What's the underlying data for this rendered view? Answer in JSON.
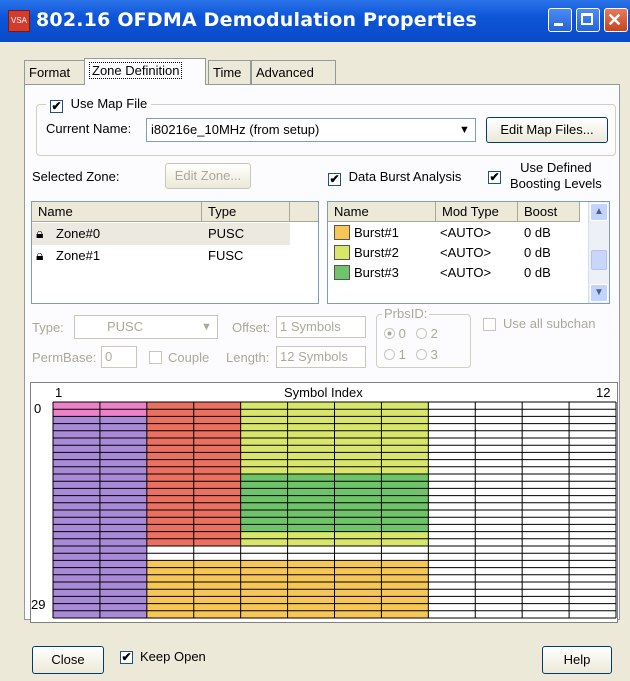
{
  "window": {
    "title": "802.16 OFDMA Demodulation Properties",
    "app_icon": "VSA"
  },
  "tabs": [
    {
      "label": "Format"
    },
    {
      "label": "Zone Definition"
    },
    {
      "label": "Time"
    },
    {
      "label": "Advanced"
    }
  ],
  "map_file": {
    "use_label": "Use Map File",
    "current_name_label": "Current Name:",
    "current_name_value": "i80216e_10MHz (from setup)",
    "edit_button": "Edit Map Files..."
  },
  "selected_zone": {
    "label": "Selected Zone:",
    "edit_button": "Edit Zone..."
  },
  "options": {
    "data_burst_analysis": "Data Burst Analysis",
    "use_defined_line1": "Use Defined",
    "use_defined_line2": "Boosting Levels"
  },
  "zones": {
    "headers": [
      "Name",
      "Type"
    ],
    "rows": [
      {
        "name": "Zone#0",
        "type": "PUSC"
      },
      {
        "name": "Zone#1",
        "type": "FUSC"
      }
    ]
  },
  "bursts": {
    "headers": [
      "Name",
      "Mod Type",
      "Boost"
    ],
    "rows": [
      {
        "name": "Burst#1",
        "mod": "<AUTO>",
        "boost": "0 dB",
        "color": "#f6c656"
      },
      {
        "name": "Burst#2",
        "mod": "<AUTO>",
        "boost": "0 dB",
        "color": "#d8e66a"
      },
      {
        "name": "Burst#3",
        "mod": "<AUTO>",
        "boost": "0 dB",
        "color": "#6fc46a"
      }
    ]
  },
  "zone_params": {
    "type_label": "Type:",
    "type_value": "PUSC",
    "offset_label": "Offset:",
    "offset_value": "1 Symbols",
    "prbsid_label": "PrbsID:",
    "prbs_options": [
      "0",
      "2",
      "1",
      "3"
    ],
    "use_all_subchan": "Use all subchan",
    "permbase_label": "PermBase:",
    "permbase_value": "0",
    "couple_label": "Couple",
    "length_label": "Length:",
    "length_value": "12 Symbols"
  },
  "symbol_map": {
    "title": "Symbol Index",
    "x_start": "1",
    "x_end": "12",
    "y_start": "0",
    "y_end": "29",
    "columns": 12,
    "rows": 30,
    "colors": {
      "pink": "#ee82c8",
      "purple": "#a98ad8",
      "red": "#ec7060",
      "yellow": "#f6c656",
      "lime": "#d8e66a",
      "green": "#6fc46a"
    },
    "regions": [
      {
        "color": "pink",
        "col0": 0,
        "col1": 2,
        "row0": 0,
        "row1": 2
      },
      {
        "color": "purple",
        "col0": 0,
        "col1": 2,
        "row0": 2,
        "row1": 30
      },
      {
        "color": "red",
        "col0": 2,
        "col1": 4,
        "row0": 0,
        "row1": 20
      },
      {
        "color": "lime",
        "col0": 4,
        "col1": 8,
        "row0": 0,
        "row1": 10
      },
      {
        "color": "green",
        "col0": 4,
        "col1": 8,
        "row0": 10,
        "row1": 18
      },
      {
        "color": "lime",
        "col0": 4,
        "col1": 8,
        "row0": 18,
        "row1": 20
      },
      {
        "color": "yellow",
        "col0": 2,
        "col1": 8,
        "row0": 22,
        "row1": 30
      }
    ]
  },
  "footer": {
    "close_button": "Close",
    "keep_open": "Keep Open",
    "help_button": "Help"
  }
}
